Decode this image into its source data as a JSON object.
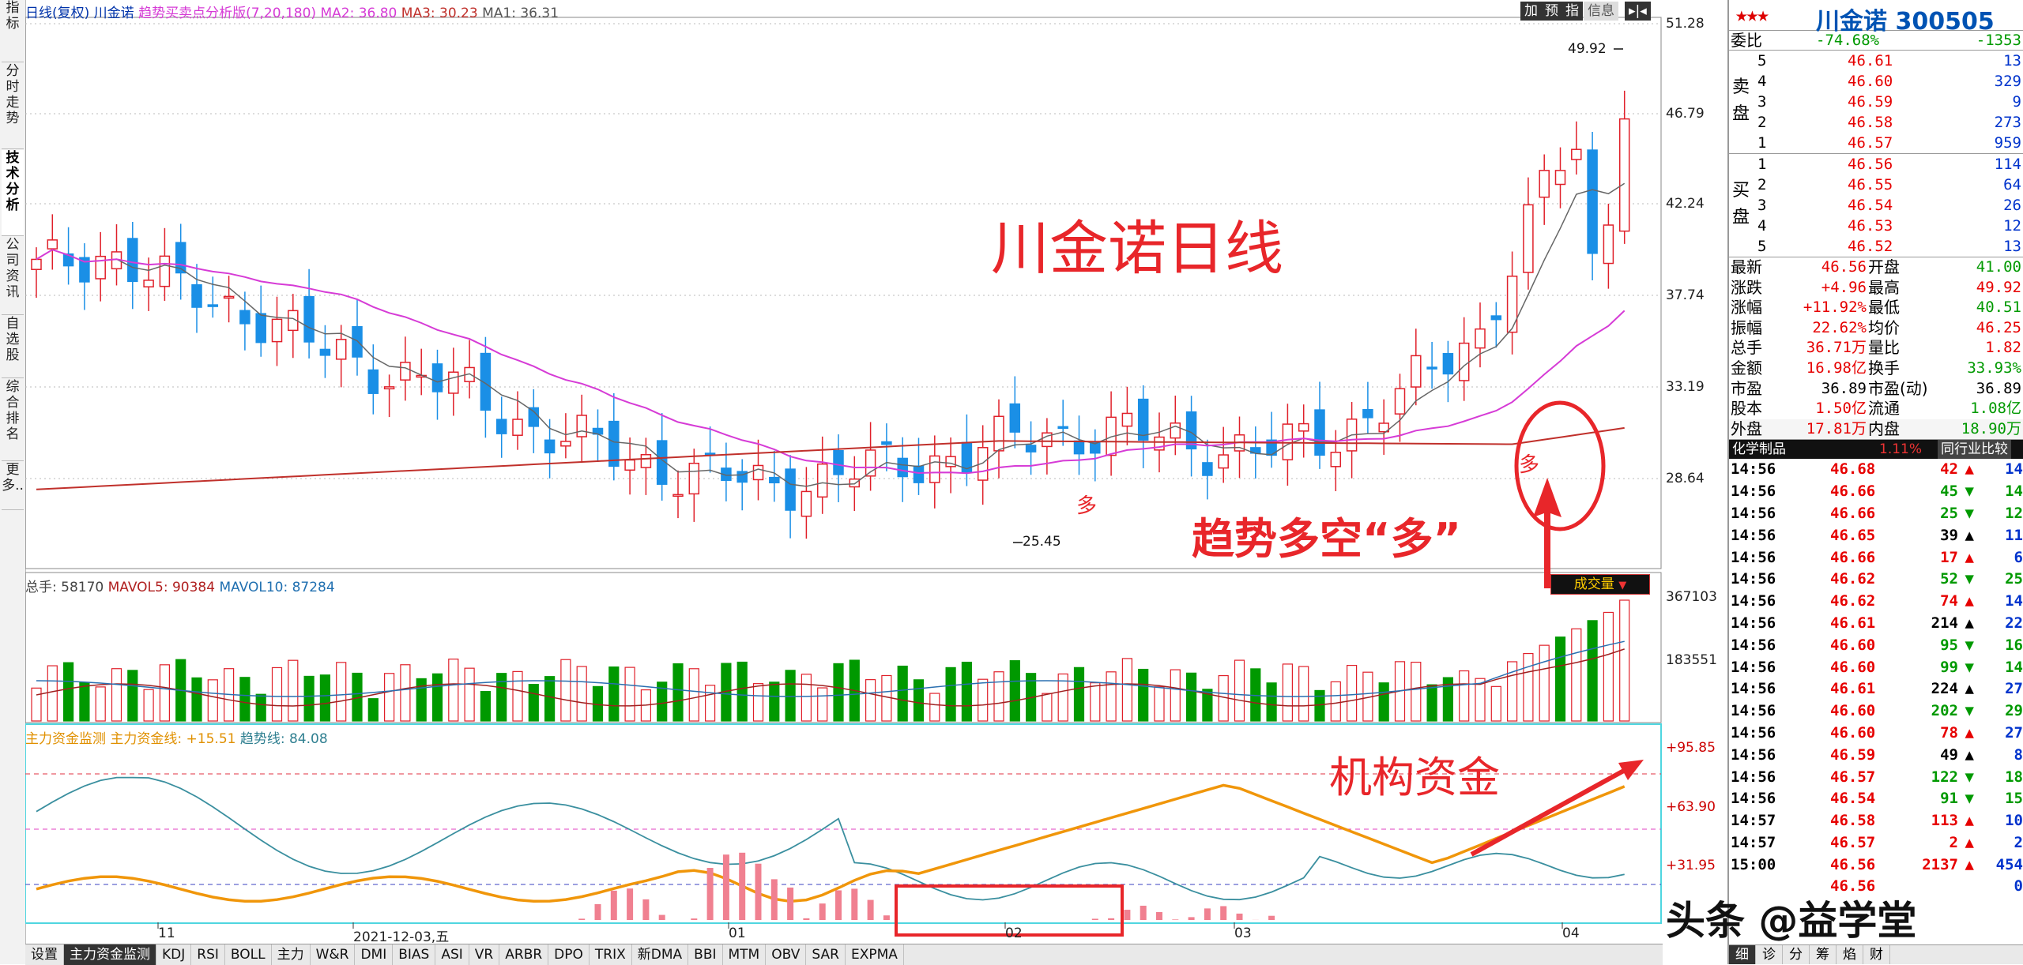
{
  "left_nav": [
    {
      "label": "指标",
      "active": false
    },
    {
      "label": "分时走势",
      "active": false
    },
    {
      "label": "技术分析",
      "active": true
    },
    {
      "label": "公司资讯",
      "active": false
    },
    {
      "label": "自选股",
      "active": false
    },
    {
      "label": "综合排名",
      "active": false
    },
    {
      "label": "更多..",
      "active": false
    }
  ],
  "header": {
    "mode": "日线(复权)",
    "stock": "川金诺",
    "indicator": "趋势买卖点分析版(7,20,180)",
    "ma2": "MA2: 36.80",
    "ma3": "MA3: 30.23",
    "ma1": "MA1: 36.31",
    "top_buttons": [
      "加",
      "预",
      "指",
      "信息",
      "▸|◂"
    ]
  },
  "price_axis": [
    "51.28",
    "46.79",
    "42.24",
    "37.74",
    "33.19",
    "28.64"
  ],
  "volume_axis": [
    "367103",
    "183551"
  ],
  "flow_axis": [
    "+95.85",
    "+63.90",
    "+31.95"
  ],
  "volume_header": {
    "total": "总手: 58170",
    "mavol5": "MAVOL5: 90384",
    "mavol10": "MAVOL10: 87284",
    "button": "成交量"
  },
  "flow_header": {
    "title": "主力资金监测",
    "line": "主力资金线: +15.51",
    "trend": "趋势线: 84.08"
  },
  "x_axis": [
    "11",
    "2021-12-03,五",
    "01",
    "02",
    "03",
    "04"
  ],
  "annotations": {
    "title": "川金诺日线",
    "signal": "趋势多空“多”",
    "fund": "机构资金",
    "duo1": "多",
    "duo2": "多",
    "high_label": "49.92",
    "low_label": "25.45"
  },
  "tabs": [
    {
      "label": "设置",
      "active": false
    },
    {
      "label": "主力资金监测",
      "active": true
    },
    {
      "label": "KDJ",
      "active": false
    },
    {
      "label": "RSI",
      "active": false
    },
    {
      "label": "BOLL",
      "active": false
    },
    {
      "label": "主力",
      "active": false
    },
    {
      "label": "W&R",
      "active": false
    },
    {
      "label": "DMI",
      "active": false
    },
    {
      "label": "BIAS",
      "active": false
    },
    {
      "label": "ASI",
      "active": false
    },
    {
      "label": "VR",
      "active": false
    },
    {
      "label": "ARBR",
      "active": false
    },
    {
      "label": "DPO",
      "active": false
    },
    {
      "label": "TRIX",
      "active": false
    },
    {
      "label": "新DMA",
      "active": false
    },
    {
      "label": "BBI",
      "active": false
    },
    {
      "label": "MTM",
      "active": false
    },
    {
      "label": "OBV",
      "active": false
    },
    {
      "label": "SAR",
      "active": false
    },
    {
      "label": "EXPMA",
      "active": false
    }
  ],
  "quote": {
    "stars": "★★★",
    "title": "川金诺 300505",
    "weibi": {
      "label": "委比",
      "pct": "-74.68%",
      "diff": "-1353"
    },
    "sell_label": "卖盘",
    "buy_label": "买盘",
    "sell": [
      {
        "lvl": "5",
        "price": "46.61",
        "vol": "13"
      },
      {
        "lvl": "4",
        "price": "46.60",
        "vol": "329"
      },
      {
        "lvl": "3",
        "price": "46.59",
        "vol": "9"
      },
      {
        "lvl": "2",
        "price": "46.58",
        "vol": "273"
      },
      {
        "lvl": "1",
        "price": "46.57",
        "vol": "959"
      }
    ],
    "buy": [
      {
        "lvl": "1",
        "price": "46.56",
        "vol": "114"
      },
      {
        "lvl": "2",
        "price": "46.55",
        "vol": "64"
      },
      {
        "lvl": "3",
        "price": "46.54",
        "vol": "26"
      },
      {
        "lvl": "4",
        "price": "46.53",
        "vol": "12"
      },
      {
        "lvl": "5",
        "price": "46.52",
        "vol": "13"
      }
    ],
    "stats": [
      {
        "l1": "最新",
        "v1": "46.56",
        "c1": "up",
        "l2": "开盘",
        "v2": "41.00",
        "c2": "dn"
      },
      {
        "l1": "涨跌",
        "v1": "+4.96",
        "c1": "up",
        "l2": "最高",
        "v2": "49.92",
        "c2": "up"
      },
      {
        "l1": "涨幅",
        "v1": "+11.92%",
        "c1": "up",
        "l2": "最低",
        "v2": "40.51",
        "c2": "dn"
      },
      {
        "l1": "振幅",
        "v1": "22.62%",
        "c1": "up",
        "l2": "均价",
        "v2": "46.25",
        "c2": "up"
      },
      {
        "l1": "总手",
        "v1": "36.71万",
        "c1": "up",
        "l2": "量比",
        "v2": "1.82",
        "c2": "up"
      },
      {
        "l1": "金额",
        "v1": "16.98亿",
        "c1": "up",
        "l2": "换手",
        "v2": "33.93%",
        "c2": "dn"
      },
      {
        "l1": "市盈",
        "v1": "36.89",
        "c1": "blk",
        "l2": "市盈(动)",
        "v2": "36.89",
        "c2": "blk"
      },
      {
        "l1": "股本",
        "v1": "1.50亿",
        "c1": "up",
        "l2": "流通",
        "v2": "1.08亿",
        "c2": "dn"
      },
      {
        "l1": "外盘",
        "v1": "17.81万",
        "c1": "up",
        "l2": "内盘",
        "v2": "18.90万",
        "c2": "dn"
      }
    ],
    "ticks_head": {
      "sector": "化学制品",
      "pct": "1.11%",
      "btn": "同行业比较"
    },
    "ticks": [
      {
        "t": "14:56",
        "p": "46.68",
        "v": "42",
        "d": "up",
        "n": "14"
      },
      {
        "t": "14:56",
        "p": "46.66",
        "v": "45",
        "d": "dn",
        "n": "14"
      },
      {
        "t": "14:56",
        "p": "46.66",
        "v": "25",
        "d": "dn",
        "n": "12"
      },
      {
        "t": "14:56",
        "p": "46.65",
        "v": "39",
        "d": "blk",
        "n": "11"
      },
      {
        "t": "14:56",
        "p": "46.66",
        "v": "17",
        "d": "up",
        "n": "6"
      },
      {
        "t": "14:56",
        "p": "46.62",
        "v": "52",
        "d": "dn",
        "n": "25"
      },
      {
        "t": "14:56",
        "p": "46.62",
        "v": "74",
        "d": "up",
        "n": "14"
      },
      {
        "t": "14:56",
        "p": "46.61",
        "v": "214",
        "d": "blk",
        "n": "22"
      },
      {
        "t": "14:56",
        "p": "46.60",
        "v": "95",
        "d": "dn",
        "n": "16"
      },
      {
        "t": "14:56",
        "p": "46.60",
        "v": "99",
        "d": "dn",
        "n": "14"
      },
      {
        "t": "14:56",
        "p": "46.61",
        "v": "224",
        "d": "blk",
        "n": "27"
      },
      {
        "t": "14:56",
        "p": "46.60",
        "v": "202",
        "d": "dn",
        "n": "29"
      },
      {
        "t": "14:56",
        "p": "46.60",
        "v": "78",
        "d": "up",
        "n": "27"
      },
      {
        "t": "14:56",
        "p": "46.59",
        "v": "49",
        "d": "blk",
        "n": "8"
      },
      {
        "t": "14:56",
        "p": "46.57",
        "v": "122",
        "d": "dn",
        "n": "18"
      },
      {
        "t": "14:56",
        "p": "46.54",
        "v": "91",
        "d": "dn",
        "n": "15"
      },
      {
        "t": "14:57",
        "p": "46.58",
        "v": "113",
        "d": "up",
        "n": "10"
      },
      {
        "t": "14:57",
        "p": "46.57",
        "v": "2",
        "d": "up",
        "n": "2"
      },
      {
        "t": "15:00",
        "p": "46.56",
        "v": "2137",
        "d": "up",
        "n": "454"
      },
      {
        "t": "",
        "p": "46.56",
        "v": "",
        "d": "blk",
        "n": "0"
      }
    ],
    "footer": [
      {
        "label": "细",
        "active": true
      },
      {
        "label": "诊",
        "active": false
      },
      {
        "label": "分",
        "active": false
      },
      {
        "label": "筹",
        "active": false
      },
      {
        "label": "焰",
        "active": false
      },
      {
        "label": "财",
        "active": false
      }
    ]
  },
  "watermark": "头条 @益学堂",
  "colors": {
    "up": "#e60000",
    "down": "#009900",
    "candle_up": "#e0202a",
    "candle_down": "#1a8fe6",
    "ma_pink": "#d63bd6",
    "ma_red": "#c0302b",
    "ma_gray": "#666666",
    "flow_orange": "#f0960a",
    "flow_blue": "#3a8f9f"
  },
  "chart_data": [
    {
      "type": "candlestick",
      "name": "price",
      "ylim": [
        25.45,
        51.28
      ],
      "high": 49.92,
      "low": 25.45,
      "trend": [
        39,
        40,
        38,
        37,
        35,
        34,
        33,
        31,
        30,
        29,
        28.5,
        28.8,
        29.5,
        30,
        31,
        31,
        30.5,
        30,
        31,
        33,
        36,
        44,
        46.56
      ]
    },
    {
      "type": "bar",
      "name": "volume",
      "ylim": [
        0,
        367103
      ],
      "last": 58170,
      "mavol5": 90384,
      "mavol10": 87284
    },
    {
      "type": "line",
      "name": "fund_flow",
      "ylim": [
        0,
        95.85
      ],
      "line_value": 15.51,
      "trend_value": 84.08
    }
  ]
}
